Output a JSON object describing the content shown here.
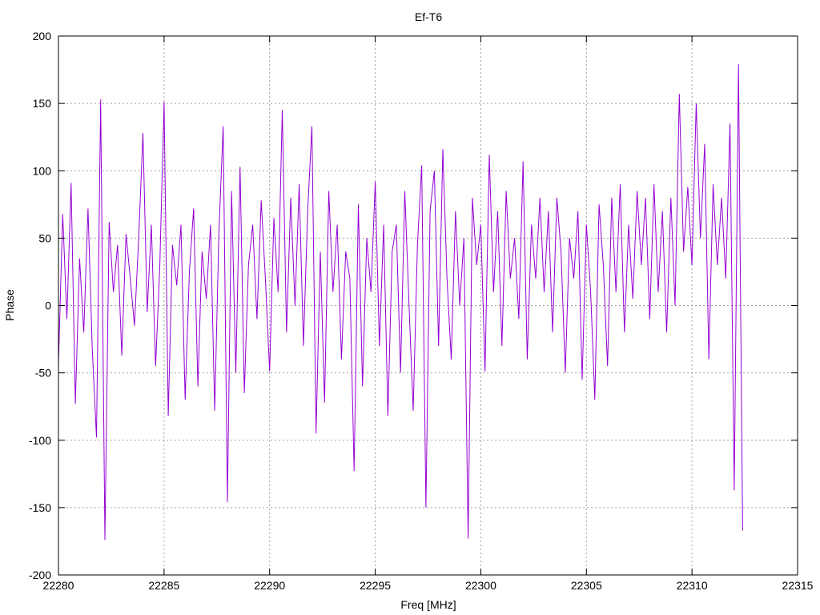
{
  "chart_data": {
    "type": "line",
    "title": "Ef-T6",
    "xlabel": "Freq [MHz]",
    "ylabel": "Phase",
    "xlim": [
      22280,
      22315
    ],
    "ylim": [
      -200,
      200
    ],
    "xticks": [
      22280,
      22285,
      22290,
      22295,
      22300,
      22305,
      22310,
      22315
    ],
    "yticks": [
      -200,
      -150,
      -100,
      -50,
      0,
      50,
      100,
      150,
      200
    ],
    "grid": true,
    "line_color": "#9400d3",
    "series": [
      {
        "name": "Ef-T6",
        "x_start": 22280,
        "x_step": 0.2,
        "values": [
          -44,
          68,
          -10,
          91,
          -73,
          35,
          -20,
          72,
          -32,
          -98,
          153,
          -174,
          62,
          10,
          45,
          -37,
          53,
          20,
          -15,
          50,
          128,
          -5,
          60,
          -45,
          30,
          151,
          -82,
          45,
          15,
          60,
          -70,
          25,
          72,
          -60,
          40,
          5,
          60,
          -78,
          55,
          133,
          -146,
          85,
          -50,
          103,
          -65,
          30,
          60,
          -10,
          78,
          20,
          -49,
          65,
          10,
          145,
          -20,
          80,
          0,
          90,
          -30,
          70,
          133,
          -95,
          40,
          -72,
          85,
          10,
          60,
          -40,
          40,
          20,
          -123,
          75,
          -60,
          50,
          10,
          92,
          -30,
          60,
          -82,
          40,
          60,
          -50,
          85,
          0,
          -78,
          45,
          104,
          -150,
          70,
          100,
          -30,
          116,
          20,
          -40,
          70,
          0,
          50,
          -173,
          80,
          30,
          60,
          -49,
          112,
          10,
          70,
          -30,
          85,
          20,
          50,
          -10,
          107,
          -40,
          60,
          20,
          80,
          10,
          70,
          -20,
          80,
          40,
          -50,
          50,
          20,
          70,
          -55,
          60,
          10,
          -70,
          75,
          30,
          -45,
          80,
          10,
          90,
          -20,
          60,
          5,
          85,
          30,
          80,
          -10,
          90,
          10,
          70,
          -20,
          80,
          0,
          157,
          40,
          88,
          30,
          150,
          50,
          120,
          -40,
          90,
          30,
          80,
          20,
          135,
          -137,
          179,
          -167
        ]
      }
    ]
  }
}
